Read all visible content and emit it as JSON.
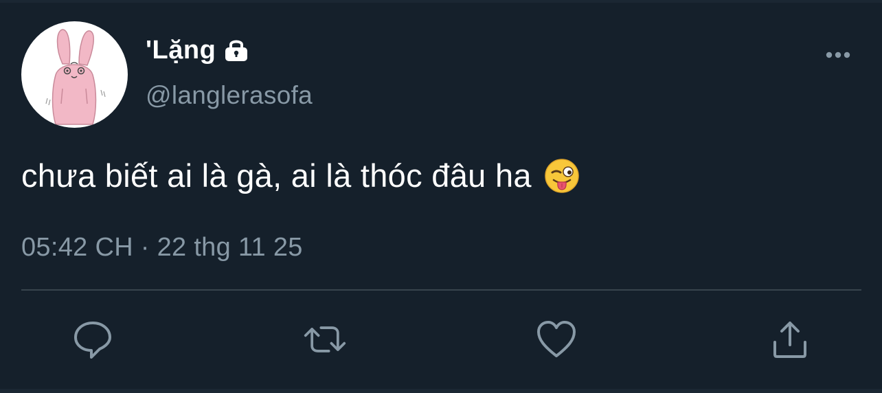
{
  "colors": {
    "background": "#15202b",
    "text_primary": "#ffffff",
    "text_secondary": "#8899a6",
    "divider": "#38444d",
    "avatar_bg": "#ffffff",
    "avatar_bunny": "#f2b8c6"
  },
  "tweet": {
    "author": {
      "display_name": "'Lặng",
      "handle": "@langlerasofa",
      "protected_icon": "lock-icon",
      "avatar": "bunny-avatar"
    },
    "more_icon": "more-options-icon",
    "text": "chưa biết ai là gà, ai là thóc đâu ha",
    "emoji": "winking-face-with-tongue",
    "timestamp": "05:42 CH · 22 thg 11 25",
    "actions": [
      {
        "name": "reply",
        "icon": "reply-icon"
      },
      {
        "name": "retweet",
        "icon": "retweet-icon"
      },
      {
        "name": "like",
        "icon": "heart-icon"
      },
      {
        "name": "share",
        "icon": "share-icon"
      }
    ]
  }
}
